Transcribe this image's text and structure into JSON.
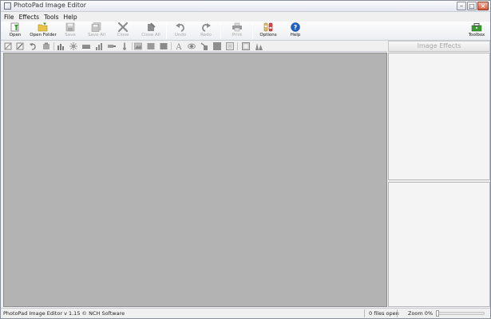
{
  "window": {
    "title": "PhotoPad Image Editor"
  },
  "menu": [
    "File",
    "Effects",
    "Tools",
    "Help"
  ],
  "toolbar": {
    "open": "Open",
    "open_folder": "Open Folder",
    "save": "Save",
    "save_all": "Save All",
    "close": "Close",
    "close_all": "Close All",
    "undo": "Undo",
    "redo": "Redo",
    "print": "Print",
    "options": "Options",
    "help": "Help",
    "toolbox": "Toolbox"
  },
  "small_tools": [
    "crop-icon",
    "straighten-icon",
    "rotate-icon",
    "resize-icon",
    "levels-icon",
    "brightness-icon",
    "contrast-icon",
    "histogram-icon",
    "saturation-icon",
    "temperature-icon",
    "photo-effect-icon",
    "filter-icon-1",
    "filter-icon-2",
    "text-icon",
    "red-eye-icon",
    "retouch-icon",
    "fill-icon",
    "border-icon",
    "frame-icon",
    "effects-icon"
  ],
  "panel": {
    "header": "Image Effects"
  },
  "status": {
    "copyright": "PhotoPad Image Editor v 1.15 © NCH Software",
    "files_open": "0 files open",
    "zoom_label": "Zoom 0%",
    "zoom_value": 0
  },
  "colors": {
    "canvas": "#b3b3b3",
    "chrome": "#f0f0f0",
    "help_blue": "#1f5fc6",
    "open_green": "#3a9a2f"
  }
}
